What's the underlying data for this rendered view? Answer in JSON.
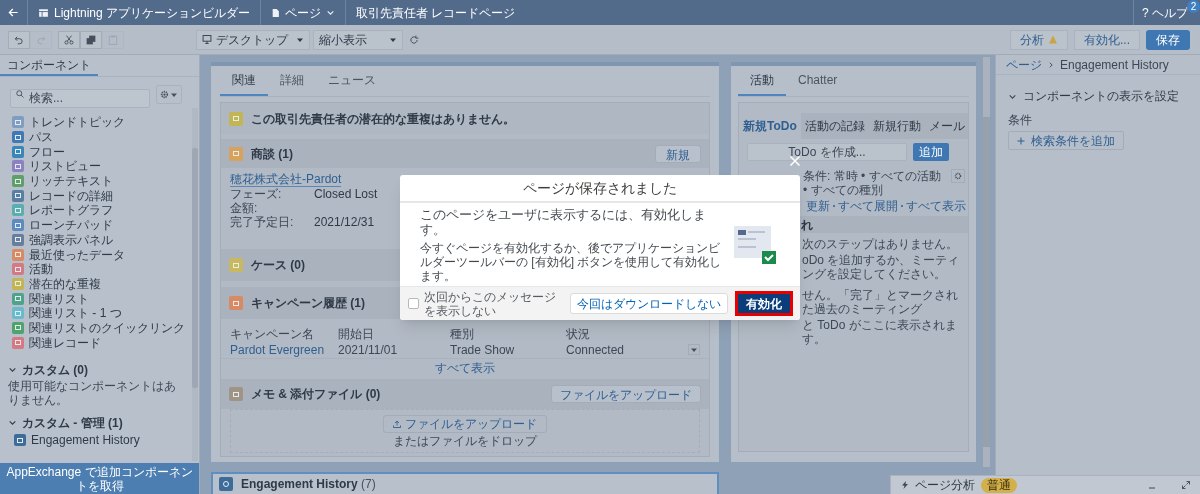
{
  "top_bar": {
    "app_title": "Lightning アプリケーションビルダー",
    "page_menu": "ページ",
    "page_name": "取引先責任者 レコードページ",
    "help": {
      "icon": "?",
      "label": "ヘルプ",
      "badge": "2"
    }
  },
  "toolbar": {
    "actions": [
      {
        "kind": "undo",
        "disabled": false
      },
      {
        "kind": "redo",
        "disabled": true
      },
      {
        "kind": "cut",
        "disabled": false
      },
      {
        "kind": "copy",
        "disabled": false
      },
      {
        "kind": "paste",
        "disabled": true
      }
    ],
    "device": "デスクトップ",
    "view": "縮小表示",
    "buttons": [
      {
        "kind": "analysis",
        "label": "分析"
      },
      {
        "kind": "secondary",
        "label": "有効化..."
      },
      {
        "kind": "primary",
        "label": "保存"
      }
    ]
  },
  "sidebar": {
    "tab": "コンポーネント",
    "search_placeholder": "検索...",
    "items": [
      {
        "label": "トレンドトピック",
        "color": "#7f9dc2"
      },
      {
        "label": "パス",
        "color": "#3f79b6"
      },
      {
        "label": "フロー",
        "color": "#3b86b8"
      },
      {
        "label": "リストビュー",
        "color": "#8c82c2"
      },
      {
        "label": "リッチテキスト",
        "color": "#5f9f6a"
      },
      {
        "label": "レコードの詳細",
        "color": "#5a7ea3"
      },
      {
        "label": "レポートグラフ",
        "color": "#5aaeb0"
      },
      {
        "label": "ローンチパッド",
        "color": "#5b8bc0"
      },
      {
        "label": "強調表示パネル",
        "color": "#667f9c"
      },
      {
        "label": "最近使ったデータ",
        "color": "#d98a63"
      },
      {
        "label": "活動",
        "color": "#d67983"
      },
      {
        "label": "潜在的な重複",
        "color": "#c2b554"
      },
      {
        "label": "関連リスト",
        "color": "#4ea38a"
      },
      {
        "label": "関連リスト - 1 つ",
        "color": "#67bbcc"
      },
      {
        "label": "関連リストのクイックリンク",
        "color": "#4fa36c"
      },
      {
        "label": "関連レコード",
        "color": "#d67983"
      }
    ],
    "sections": [
      {
        "title": "カスタム (0)",
        "expanded": true,
        "empty_text": "使用可能なコンポーネントはありません。"
      },
      {
        "title": "カスタム - 管理 (1)",
        "expanded": true,
        "items": [
          {
            "label": "Engagement History",
            "color": "#3d6c9b"
          }
        ]
      }
    ],
    "appexchange": "AppExchange で追加コンポーネントを取得"
  },
  "main_column": {
    "tabs": [
      {
        "label": "関連",
        "selected": true
      },
      {
        "label": "詳細",
        "selected": false
      },
      {
        "label": "ニュース",
        "selected": false
      }
    ],
    "duplicates": "この取引先責任者の潜在的な重複はありません。",
    "opportunities": {
      "title": "商談 (1)",
      "button": "新規",
      "record": {
        "link": "穂花株式会社-Pardot",
        "fields": [
          {
            "label": "フェーズ:",
            "value": "Closed Lost"
          },
          {
            "label": "金額:"
          },
          {
            "label": "完了予定日:",
            "value": "2021/12/31"
          }
        ]
      }
    },
    "cases": {
      "title": "ケース (0)"
    },
    "campaigns": {
      "title": "キャンペーン履歴 (1)",
      "columns": [
        "キャンペーン名",
        "開始日",
        "種別",
        "状況"
      ],
      "rows": [
        [
          "Pardot Evergreen",
          "2021/11/01",
          "Trade Show",
          "Connected"
        ]
      ],
      "view_all": "すべて表示"
    },
    "notes": {
      "title": "メモ & 添付ファイル (0)",
      "button": "ファイルをアップロード",
      "upload_button": "ファイルをアップロード",
      "drop_text": "またはファイルをドロップ"
    },
    "selected_component": {
      "title": "Engagement History",
      "count": "(7)"
    }
  },
  "activity_column": {
    "tabs": [
      {
        "label": "活動",
        "selected": true
      },
      {
        "label": "Chatter",
        "selected": false
      }
    ],
    "subtabs": [
      {
        "label": "新規ToDo",
        "selected": true
      },
      {
        "label": "活動の記録",
        "selected": false
      },
      {
        "label": "新規行動",
        "selected": false
      },
      {
        "label": "メール",
        "selected": false
      }
    ],
    "todo_placeholder": "ToDo を作成...",
    "add_button": "追加",
    "filter": "条件: 常時 • すべての活動 • すべての種別",
    "links": [
      "更新",
      "すべて展開",
      "すべて表示"
    ],
    "section_fragment": "れ",
    "messages": [
      "次のステップはありません。",
      "oDo を追加するか、ミーティングを設定してください。",
      "せん。「完了」とマークされた過去のミーティング",
      "と ToDo がここに表示されます。"
    ]
  },
  "properties": {
    "breadcrumb": [
      "ページ",
      "Engagement History"
    ],
    "section": {
      "title": "コンポーネントの表示を設定",
      "expanded": true
    },
    "label": "条件",
    "add_button": "検索条件を追加"
  },
  "page_analysis": {
    "label": "ページ分析",
    "badge": "普通"
  },
  "modal": {
    "title": "ページが保存されました",
    "lead": "このページをユーザに表示するには、有効化します。",
    "text": "今すぐページを有効化するか、後でアプリケーションビルダーツールバーの [有効化] ボタンを使用して有効化します。",
    "checkbox": {
      "label": "次回からこのメッセージを表示しない",
      "checked": false
    },
    "secondary_button": "今回はダウンロードしない",
    "primary_button": "有効化"
  }
}
